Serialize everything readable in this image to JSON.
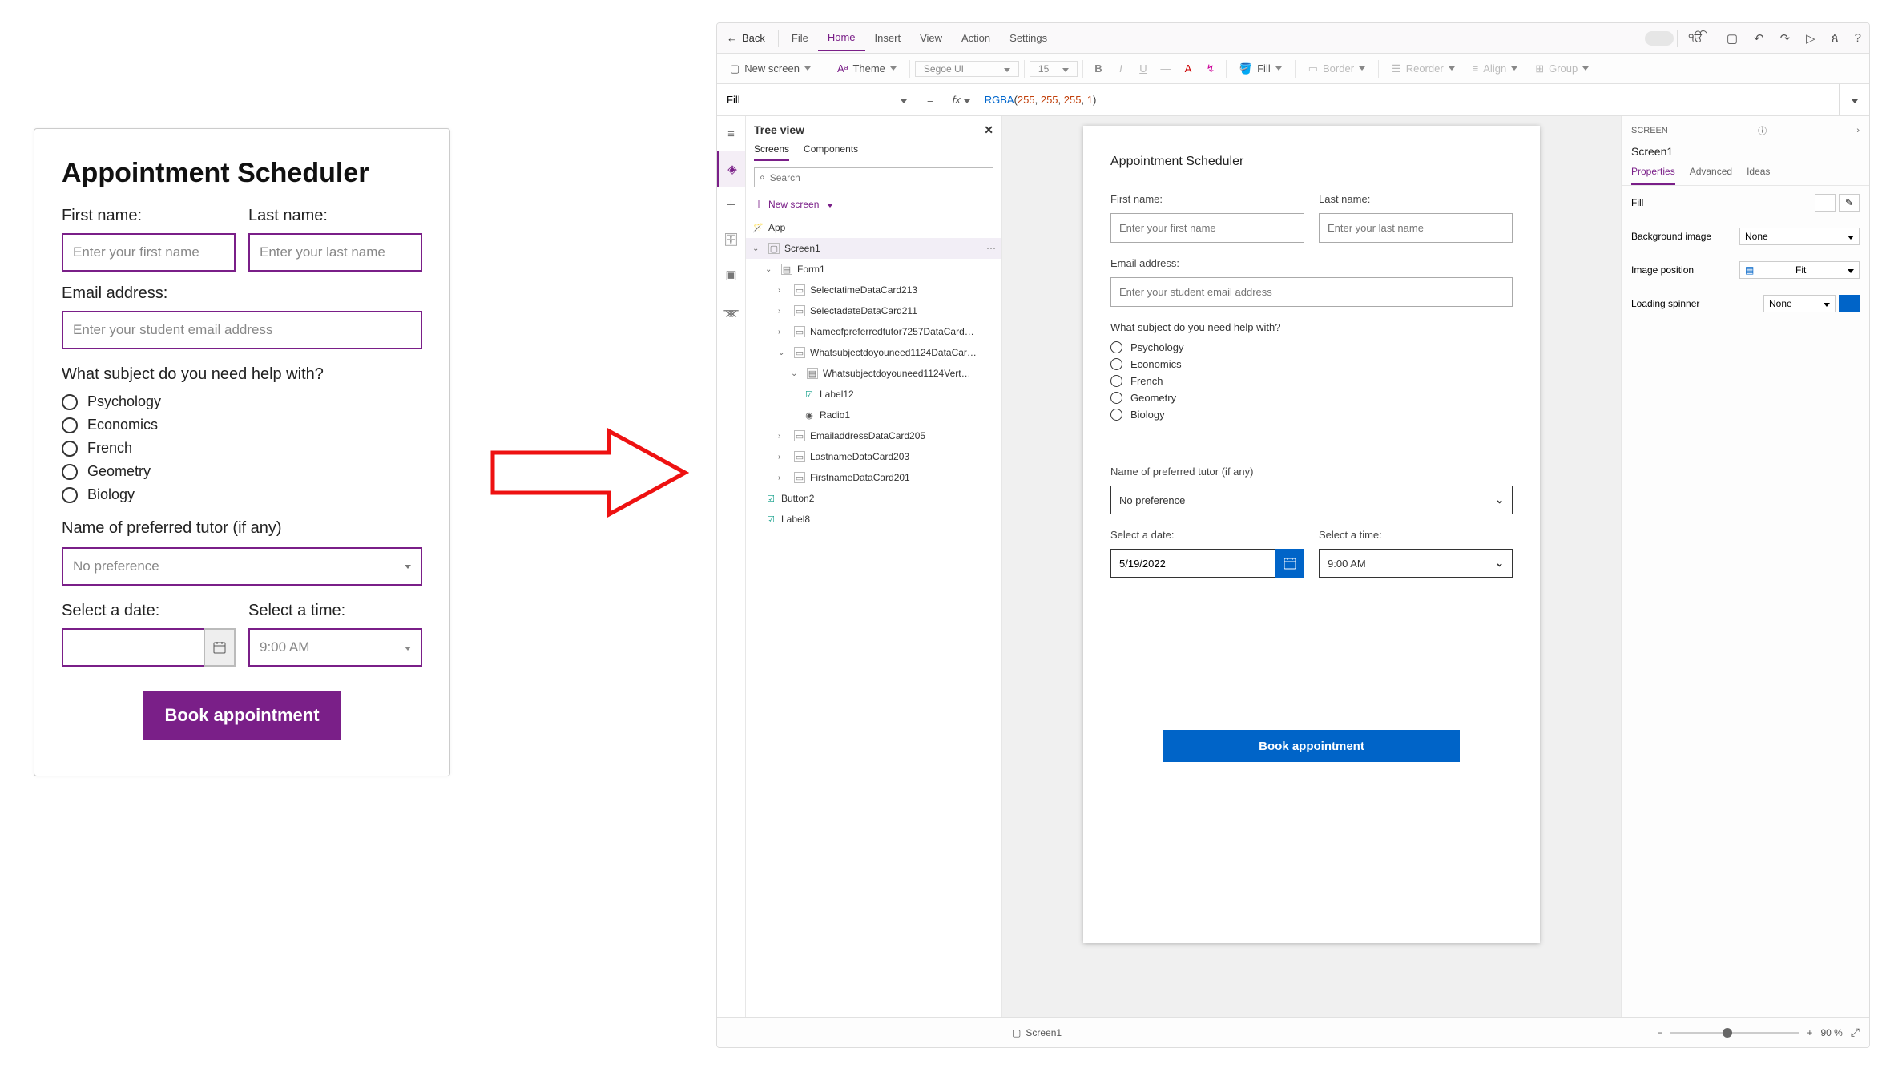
{
  "left": {
    "title": "Appointment Scheduler",
    "first_name_label": "First name:",
    "first_name_placeholder": "Enter your first name",
    "last_name_label": "Last name:",
    "last_name_placeholder": "Enter your last name",
    "email_label": "Email address:",
    "email_placeholder": "Enter your student email address",
    "subject_question": "What subject do you need help with?",
    "subjects": [
      "Psychology",
      "Economics",
      "French",
      "Geometry",
      "Biology"
    ],
    "tutor_label": "Name of preferred tutor (if any)",
    "tutor_value": "No preference",
    "date_label": "Select a date:",
    "time_label": "Select a time:",
    "time_value": "9:00 AM",
    "book_label": "Book appointment"
  },
  "pa": {
    "top": {
      "back": "Back",
      "menus": {
        "file": "File",
        "home": "Home",
        "insert": "Insert",
        "view": "View",
        "action": "Action",
        "settings": "Settings"
      }
    },
    "ribbon": {
      "new_screen": "New screen",
      "theme": "Theme",
      "font": "Segoe UI",
      "size": "15",
      "fill": "Fill",
      "border": "Border",
      "reorder": "Reorder",
      "align": "Align",
      "group": "Group"
    },
    "fx": {
      "prop": "Fill",
      "formula": {
        "fn": "RGBA",
        "args": [
          "255",
          "255",
          "255",
          "1"
        ]
      }
    },
    "tree": {
      "title": "Tree view",
      "tabs": {
        "screens": "Screens",
        "components": "Components"
      },
      "search_placeholder": "Search",
      "new_screen": "New screen",
      "items": {
        "app": "App",
        "screen1": "Screen1",
        "form1": "Form1",
        "selectatime": "SelectatimeDataCard213",
        "selectadate": "SelectadateDataCard211",
        "nameofpreferred": "Nameofpreferredtutor7257DataCard…",
        "whatsubject": "Whatsubjectdoyouneed1124DataCar…",
        "whatsubjectvert": "Whatsubjectdoyouneed1124Vert…",
        "label12": "Label12",
        "radio1": "Radio1",
        "email": "EmailaddressDataCard205",
        "lastname": "LastnameDataCard203",
        "firstname": "FirstnameDataCard201",
        "button2": "Button2",
        "label8": "Label8"
      }
    },
    "canvas": {
      "title": "Appointment Scheduler",
      "first_name_label": "First name:",
      "first_name_placeholder": "Enter your first name",
      "last_name_label": "Last name:",
      "last_name_placeholder": "Enter your last name",
      "email_label": "Email address:",
      "email_placeholder": "Enter your student email address",
      "subject_question": "What subject do you need help with?",
      "subjects": [
        "Psychology",
        "Economics",
        "French",
        "Geometry",
        "Biology"
      ],
      "tutor_label": "Name of preferred tutor (if any)",
      "tutor_value": "No preference",
      "date_label": "Select a date:",
      "date_value": "5/19/2022",
      "time_label": "Select a time:",
      "time_value": "9:00 AM",
      "book_label": "Book appointment"
    },
    "props": {
      "section": "SCREEN",
      "name": "Screen1",
      "tabs": {
        "properties": "Properties",
        "advanced": "Advanced",
        "ideas": "Ideas"
      },
      "rows": {
        "fill": "Fill",
        "bg": "Background image",
        "bg_val": "None",
        "imgpos": "Image position",
        "imgpos_val": "Fit",
        "spinner": "Loading spinner",
        "spinner_val": "None"
      }
    },
    "status": {
      "screen": "Screen1",
      "zoom": "90 %"
    }
  }
}
